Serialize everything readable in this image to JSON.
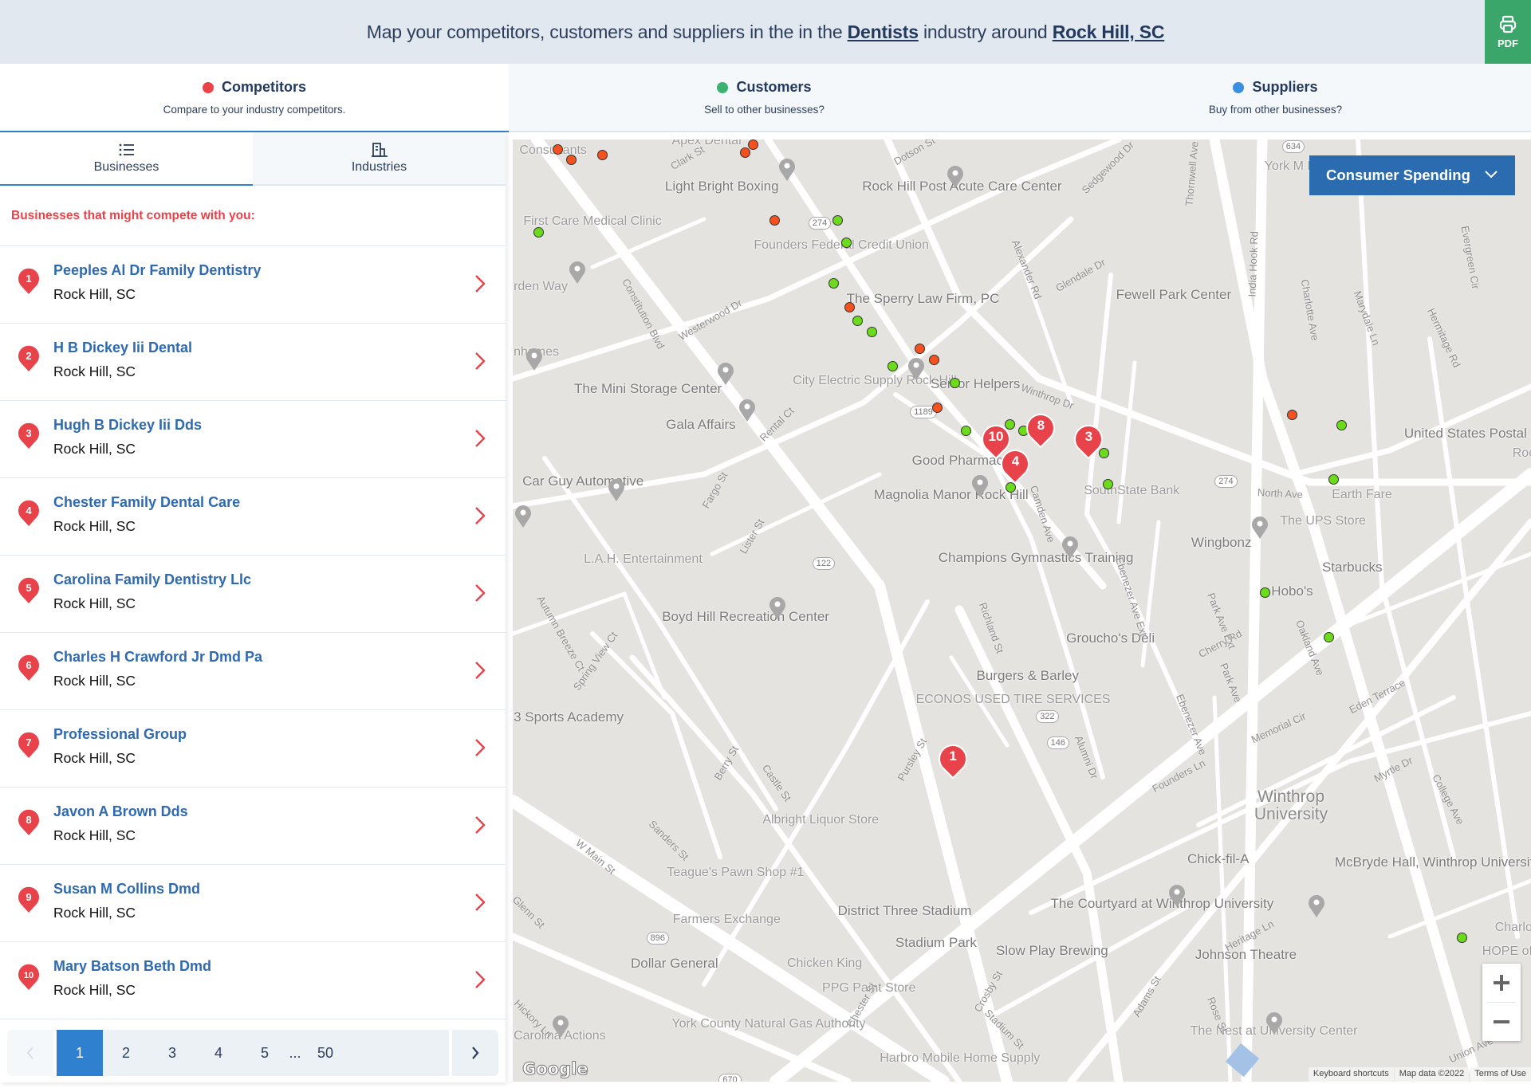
{
  "header": {
    "prefix": "Map your competitors, customers and suppliers in the in the ",
    "industry": "Dentists",
    "middle": " industry around ",
    "location": "Rock Hill, SC",
    "pdf_label": "PDF"
  },
  "top_tabs": [
    {
      "title": "Competitors",
      "subtitle": "Compare to your industry competitors.",
      "color": "#ea4449",
      "active": true
    },
    {
      "title": "Customers",
      "subtitle": "Sell to other businesses?",
      "color": "#3cb371",
      "active": false
    },
    {
      "title": "Suppliers",
      "subtitle": "Buy from other businesses?",
      "color": "#3b8ee0",
      "active": false
    }
  ],
  "sub_tabs": [
    {
      "label": "Businesses",
      "icon": "list-icon",
      "active": true
    },
    {
      "label": "Industries",
      "icon": "building-icon",
      "active": false
    }
  ],
  "list_heading": "Businesses that might compete with you:",
  "businesses": [
    {
      "rank": "1",
      "name": "Peeples Al Dr Family Dentistry",
      "city": "Rock Hill, SC"
    },
    {
      "rank": "2",
      "name": "H B Dickey Iii Dental",
      "city": "Rock Hill, SC"
    },
    {
      "rank": "3",
      "name": "Hugh B Dickey Iii Dds",
      "city": "Rock Hill, SC"
    },
    {
      "rank": "4",
      "name": "Chester Family Dental Care",
      "city": "Rock Hill, SC"
    },
    {
      "rank": "5",
      "name": "Carolina Family Dentistry Llc",
      "city": "Rock Hill, SC"
    },
    {
      "rank": "6",
      "name": "Charles H Crawford Jr Dmd Pa",
      "city": "Rock Hill, SC"
    },
    {
      "rank": "7",
      "name": "Professional Group",
      "city": "Rock Hill, SC"
    },
    {
      "rank": "8",
      "name": "Javon A Brown Dds",
      "city": "Rock Hill, SC"
    },
    {
      "rank": "9",
      "name": "Susan M Collins Dmd",
      "city": "Rock Hill, SC"
    },
    {
      "rank": "10",
      "name": "Mary Batson Beth Dmd",
      "city": "Rock Hill, SC"
    }
  ],
  "pagination": {
    "pages": [
      "1",
      "2",
      "3",
      "4",
      "5"
    ],
    "ellipsis": "...",
    "last": "50",
    "current": "1"
  },
  "map": {
    "dropdown_label": "Consumer Spending",
    "colors": {
      "competitor_pin": "#e8434a",
      "red_dot": "#f4511e",
      "green_dot": "#6cdb1c"
    },
    "competitor_pins": [
      "1",
      "3",
      "4",
      "8",
      "10"
    ],
    "poi_labels": [
      "Consultants",
      "Apex Dental",
      "Light Bright Boxing",
      "Rock Hill Post Acute Care Center",
      "First Care Medical Clinic",
      "Founders Federal Credit Union",
      "rden Way",
      "The Sperry Law Firm, PC",
      "nhomes",
      "The Mini Storage Center",
      "City Electric Supply Rock Hill",
      "Senior Helpers",
      "Gala Affairs",
      "Good Pharmacy",
      "Magnolia Manor Rock Hill",
      "Car Guy Automotive",
      "SouthState Bank",
      "Fewell Park Center",
      "York M Lodge N",
      "United States Postal Service",
      "Earth Fare",
      "The UPS Store",
      "Wingbonz",
      "Starbucks",
      "Hobo's",
      "L.A.H. Entertainment",
      "Champions Gymnastics Training",
      "Boyd Hill Recreation Center",
      "Groucho's Deli",
      "Burgers & Barley",
      "ECONOS USED TIRE SERVICES",
      "3 Sports Academy",
      "Winthrop University",
      "Albright Liquor Store",
      "Chick-fil-A",
      "McBryde Hall, Winthrop University",
      "Teague's Pawn Shop #1",
      "District Three Stadium",
      "The Courtyard at Winthrop University",
      "Farmers Exchange",
      "Stadium Park",
      "Slow Play Brewing",
      "Johnson Theatre",
      "Dollar General",
      "Chicken King",
      "PPG Paint Store",
      "York County Natural Gas Authority",
      "Carolina Actions",
      "Harbro Mobile Home Supply",
      "The Nest at University Center",
      "HOPE of",
      "Charlo",
      "Roc"
    ],
    "street_labels": [
      "Clark St",
      "Dotson St",
      "Sedgewood Dr",
      "Constitution Blvd",
      "Westerwood Dr",
      "Glendale Dr",
      "Alexander Rd",
      "Thornwell Ave",
      "India Hook Rd",
      "Charlotte Ave",
      "Marydale Ln",
      "Hermitage Rd",
      "Evergreen Cir",
      "Winthrop Dr",
      "Camden Ave",
      "North Ave",
      "Rental Ct",
      "Fargo St",
      "Lister St",
      "Cherry Rd",
      "Ebenezer Ave Ext",
      "Park Ave Ext",
      "Oakland Ave",
      "Richland St",
      "Autumn Breeze Ct",
      "Spring View Ct",
      "Eden Terrace",
      "Memorial Cir",
      "Alumni Dr",
      "Park Ave",
      "Ebenezer Ave",
      "Berry St",
      "Castle St",
      "Pursley St",
      "Founders Ln",
      "Myrtle Dr",
      "College Ave",
      "W Main St",
      "Sanders St",
      "Heritage Ln",
      "Chester St",
      "Stadium St",
      "Crosby St",
      "Hickory Ln",
      "Glenn St",
      "Union Ave",
      "Adams St",
      "Rose St"
    ],
    "route_shields": [
      "634",
      "274",
      "1189",
      "274",
      "122",
      "322",
      "146",
      "896",
      "670"
    ],
    "zoom_in": "+",
    "zoom_out": "−",
    "google_logo": "Google",
    "attribution": [
      "Keyboard shortcuts",
      "Map data ©2022",
      "Terms of Use"
    ]
  }
}
